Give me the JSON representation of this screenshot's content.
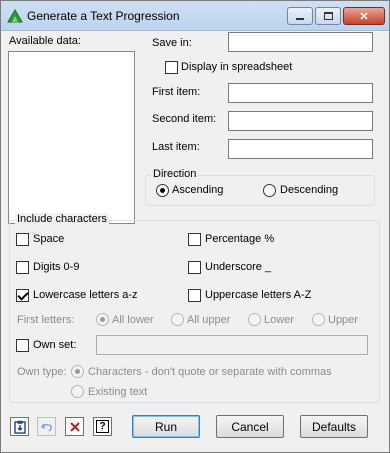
{
  "window": {
    "title": "Generate a Text Progression"
  },
  "left": {
    "available_data_label": "Available data:"
  },
  "fields": {
    "save_in_label": "Save in:",
    "display_spreadsheet_label": "Display in spreadsheet",
    "display_spreadsheet_checked": false,
    "first_item_label": "First item:",
    "second_item_label": "Second item:",
    "last_item_label": "Last item:",
    "save_in_value": "",
    "first_item_value": "",
    "second_item_value": "",
    "last_item_value": ""
  },
  "direction": {
    "title": "Direction",
    "options": [
      "Ascending",
      "Descending"
    ],
    "selected": "Ascending"
  },
  "include": {
    "title": "Include characters",
    "space": {
      "label": "Space",
      "checked": false
    },
    "percentage": {
      "label": "Percentage %",
      "checked": false
    },
    "digits": {
      "label": "Digits 0-9",
      "checked": false
    },
    "underscore": {
      "label": "Underscore _",
      "checked": false
    },
    "lowercase": {
      "label": "Lowercase letters a-z",
      "checked": true
    },
    "uppercase": {
      "label": "Uppercase letters A-Z",
      "checked": false
    },
    "first_letters_label": "First letters:",
    "first_letters_options": [
      "All lower",
      "All upper",
      "Lower",
      "Upper"
    ],
    "first_letters_selected": "All lower",
    "own_set_label": "Own set:",
    "own_set_checked": false,
    "own_type_label": "Own type:",
    "own_type_options": [
      "Characters - don't quote or separate with commas",
      "Existing text"
    ],
    "own_type_selected": "Characters - don't quote or separate with commas"
  },
  "footer": {
    "run_label": "Run",
    "cancel_label": "Cancel",
    "defaults_label": "Defaults"
  }
}
